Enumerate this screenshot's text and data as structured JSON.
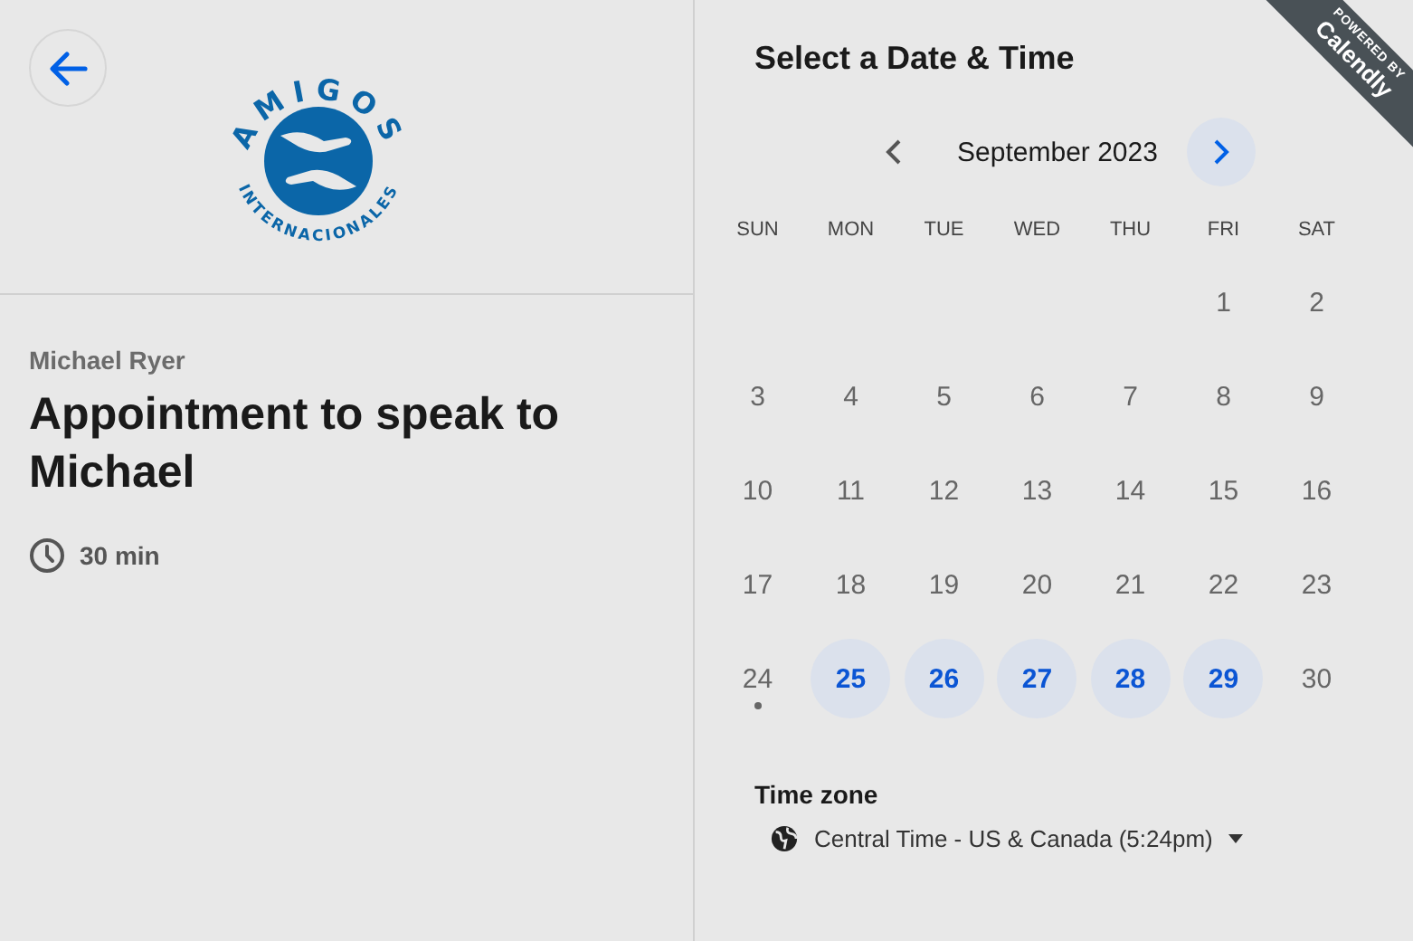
{
  "organizer": {
    "logo_top": "AMIGOS",
    "logo_bottom": "INTERNACIONALES",
    "name": "Michael Ryer",
    "event_title": "Appointment to speak to Michael",
    "duration": "30 min"
  },
  "ribbon": {
    "line_1": "POWERED BY",
    "line_2": "Calendly"
  },
  "scheduler": {
    "title": "Select a Date & Time",
    "month": "September 2023",
    "prev_enabled": false,
    "next_enabled": true,
    "weekdays": [
      "SUN",
      "MON",
      "TUE",
      "WED",
      "THU",
      "FRI",
      "SAT"
    ],
    "weeks": [
      {
        "kind": "partial",
        "days": [
          {
            "day": "1",
            "available": false,
            "today": false
          },
          {
            "day": "2",
            "available": false,
            "today": false
          }
        ]
      },
      {
        "kind": "full",
        "days": [
          {
            "day": "3",
            "available": false,
            "today": false
          },
          {
            "day": "4",
            "available": false,
            "today": false
          },
          {
            "day": "5",
            "available": false,
            "today": false
          },
          {
            "day": "6",
            "available": false,
            "today": false
          },
          {
            "day": "7",
            "available": false,
            "today": false
          },
          {
            "day": "8",
            "available": false,
            "today": false
          },
          {
            "day": "9",
            "available": false,
            "today": false
          }
        ]
      },
      {
        "kind": "full",
        "days": [
          {
            "day": "10",
            "available": false,
            "today": false
          },
          {
            "day": "11",
            "available": false,
            "today": false
          },
          {
            "day": "12",
            "available": false,
            "today": false
          },
          {
            "day": "13",
            "available": false,
            "today": false
          },
          {
            "day": "14",
            "available": false,
            "today": false
          },
          {
            "day": "15",
            "available": false,
            "today": false
          },
          {
            "day": "16",
            "available": false,
            "today": false
          }
        ]
      },
      {
        "kind": "full",
        "days": [
          {
            "day": "17",
            "available": false,
            "today": false
          },
          {
            "day": "18",
            "available": false,
            "today": false
          },
          {
            "day": "19",
            "available": false,
            "today": false
          },
          {
            "day": "20",
            "available": false,
            "today": false
          },
          {
            "day": "21",
            "available": false,
            "today": false
          },
          {
            "day": "22",
            "available": false,
            "today": false
          },
          {
            "day": "23",
            "available": false,
            "today": false
          }
        ]
      },
      {
        "kind": "full",
        "days": [
          {
            "day": "24",
            "available": false,
            "today": true
          },
          {
            "day": "25",
            "available": true,
            "today": false
          },
          {
            "day": "26",
            "available": true,
            "today": false
          },
          {
            "day": "27",
            "available": true,
            "today": false
          },
          {
            "day": "28",
            "available": true,
            "today": false
          },
          {
            "day": "29",
            "available": true,
            "today": false
          },
          {
            "day": "30",
            "available": false,
            "today": false
          }
        ]
      }
    ],
    "timezone_label": "Time zone",
    "timezone": "Central Time - US & Canada (5:24pm)"
  }
}
